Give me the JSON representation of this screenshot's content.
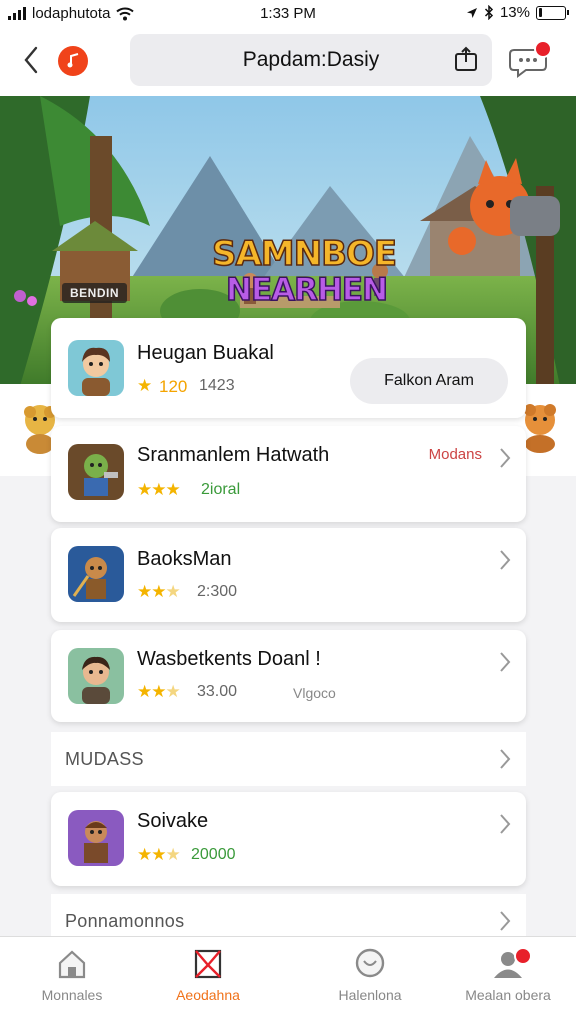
{
  "status_bar": {
    "carrier": "lodaphutota",
    "time": "1:33 PM",
    "battery": "13%",
    "battery_level": 0.13
  },
  "header": {
    "search_text": "Papdam:Dasiy",
    "chat_badge": true
  },
  "banner": {
    "title_line1": "SAMNBOE",
    "title_line2": "NEARHEN",
    "tag": "BENDIN"
  },
  "featured": {
    "name": "Heugan Buakal",
    "rating": "120",
    "count": "1423",
    "button_label": "Falkon Aram"
  },
  "items": [
    {
      "name": "Sranmanlem Hatwath",
      "rating_stars": 3,
      "sub": "2ioral",
      "tag": "Modans"
    },
    {
      "name": "BaoksMan",
      "rating_stars": 2.5,
      "sub": "2:300"
    },
    {
      "name": "Wasbetkents Doanl !",
      "rating_stars": 2.5,
      "sub": "33.00",
      "tag": "Vlgoco"
    },
    {
      "name": "Soivake",
      "rating_stars": 2.5,
      "sub": "20000"
    }
  ],
  "sections": [
    {
      "label": "MUDASS"
    },
    {
      "label": "Ponnamonnos"
    }
  ],
  "tabs": [
    {
      "label": "Monnales",
      "icon": "home-icon",
      "active": false
    },
    {
      "label": "Aeodahna",
      "icon": "bookmark-icon",
      "active": true
    },
    {
      "label": "Halenlona",
      "icon": "chat-bubble-icon",
      "active": false
    },
    {
      "label": "Mealan obera",
      "icon": "profile-icon",
      "active": false,
      "badge": true
    }
  ],
  "colors": {
    "accent": "#f0721a",
    "logo_red": "#f0431a",
    "badge_red": "#e8202a",
    "star": "#f4b400"
  }
}
